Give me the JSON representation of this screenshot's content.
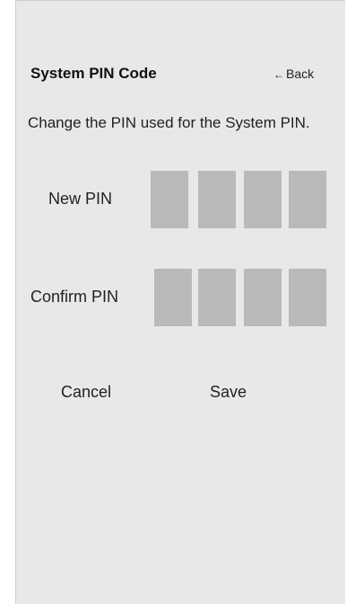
{
  "header": {
    "title": "System PIN Code",
    "back_label": "Back",
    "back_arrow": "←"
  },
  "description": "Change the PIN used for the System PIN.",
  "new_pin": {
    "label": "New PIN",
    "digits": [
      "",
      "",
      "",
      ""
    ]
  },
  "confirm_pin": {
    "label": "Confirm PIN",
    "digits": [
      "",
      "",
      "",
      ""
    ]
  },
  "actions": {
    "cancel_label": "Cancel",
    "save_label": "Save"
  },
  "colors": {
    "panel_bg": "#e8e8e8",
    "pin_box": "#b9b9b9",
    "text": "#222222"
  }
}
